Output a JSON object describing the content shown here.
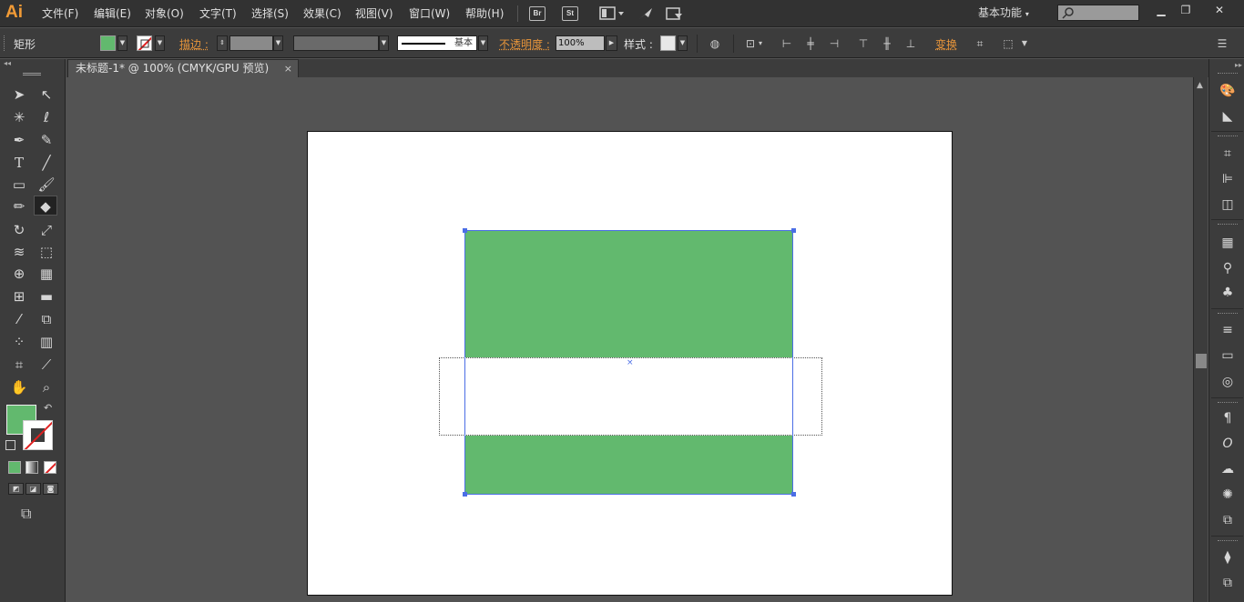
{
  "app": {
    "logo": "Ai"
  },
  "menu": [
    "文件(F)",
    "编辑(E)",
    "对象(O)",
    "文字(T)",
    "选择(S)",
    "效果(C)",
    "视图(V)",
    "窗口(W)",
    "帮助(H)"
  ],
  "menubar_icons": {
    "bridge": "Br",
    "stock": "St"
  },
  "workspace": {
    "label": "基本功能"
  },
  "window_controls": {
    "minimize": "▁",
    "restore": "❐",
    "close": "✕"
  },
  "control": {
    "object_type": "矩形",
    "fill_color": "#62b96e",
    "stroke_label": "描边 :",
    "stroke_profile": "基本",
    "opacity_label": "不透明度 :",
    "opacity_value": "100%",
    "style_label": "样式 :",
    "transform_label": "变换"
  },
  "document": {
    "tab_title": "未标题-1* @ 100% (CMYK/GPU 预览)",
    "tab_close": "×"
  },
  "colors": {
    "fill": "#62b96e",
    "selection": "#4b6ee6",
    "stroke_none": "#e02020"
  },
  "tools": [
    "selection-tool",
    "direct-selection-tool",
    "magic-wand-tool",
    "lasso-tool",
    "pen-tool",
    "curvature-tool",
    "type-tool",
    "line-segment-tool",
    "rectangle-tool",
    "paintbrush-tool",
    "pencil-tool",
    "eraser-tool",
    "rotate-tool",
    "scale-tool",
    "warp-tool",
    "free-transform-tool",
    "shape-builder-tool",
    "perspective-grid-tool",
    "mesh-tool",
    "gradient-tool",
    "eyedropper-tool",
    "blend-tool",
    "symbol-sprayer-tool",
    "column-graph-tool",
    "artboard-tool",
    "slice-tool",
    "hand-tool",
    "zoom-tool"
  ]
}
